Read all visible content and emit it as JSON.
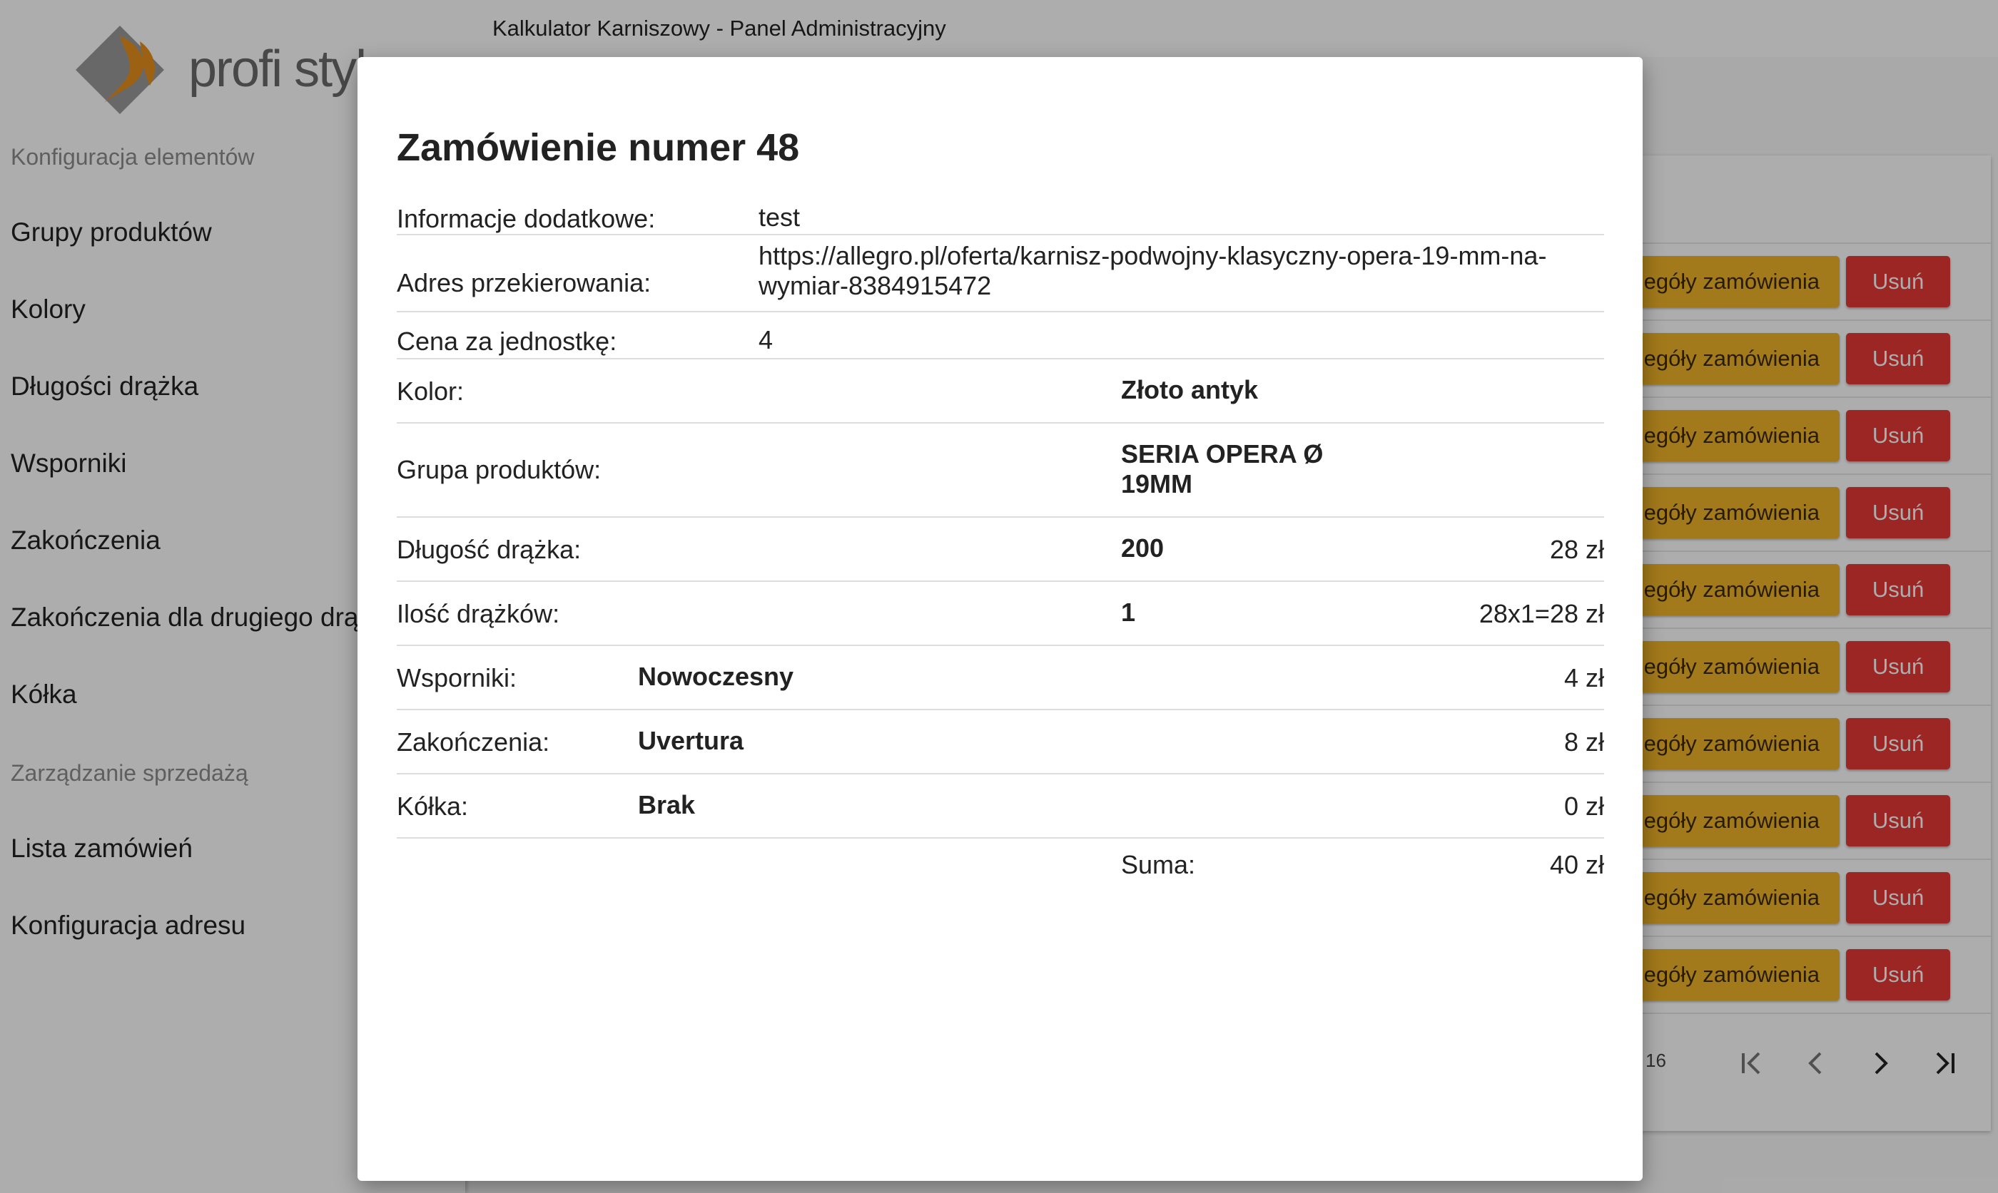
{
  "app": {
    "title": "Kalkulator Karniszowy - Panel Administracyjny",
    "logo_text": "profi styl"
  },
  "sidebar": {
    "sections": [
      {
        "title": "Konfiguracja elementów",
        "items": [
          "Grupy produktów",
          "Kolory",
          "Długości drążka",
          "Wsporniki",
          "Zakończenia",
          "Zakończenia dla drugiego drążka",
          "Kółka"
        ]
      },
      {
        "title": "Zarządzanie sprzedażą",
        "items": [
          "Lista zamówień",
          "Konfiguracja adresu"
        ]
      }
    ]
  },
  "orders_table": {
    "details_label": "Szczegóły zamówienia",
    "delete_label": "Usuń",
    "row_count": 10,
    "pager_count": "16"
  },
  "colors": {
    "details_button": "#f0b429",
    "delete_button": "#e53935",
    "logo_orange": "#e8901c",
    "logo_gray": "#9a9a9a"
  },
  "modal": {
    "title": "Zamówienie numer 48",
    "info": [
      {
        "label": "Informacje dodatkowe:",
        "value": "test"
      },
      {
        "label": "Adres przekierowania:",
        "value": "https://allegro.pl/oferta/karnisz-podwojny-klasyczny-opera-19-mm-na-wymiar-8384915472"
      },
      {
        "label": "Cena za jednostkę:",
        "value": "4"
      }
    ],
    "details": [
      {
        "label": "Kolor:",
        "value": "Złoto antyk",
        "price": ""
      },
      {
        "label": "Grupa produktów:",
        "value": "SERIA OPERA Ø 19MM",
        "price": ""
      },
      {
        "label": "Długość drążka:",
        "value": "200",
        "price": "28 zł"
      },
      {
        "label": "Ilość drążków:",
        "value": "1",
        "price": "28x1=28 zł"
      }
    ],
    "parts": [
      {
        "label": "Wsporniki:",
        "value": "Nowoczesny",
        "price": "4 zł"
      },
      {
        "label": "Zakończenia:",
        "value": "Uvertura",
        "price": "8 zł"
      },
      {
        "label": "Kółka:",
        "value": "Brak",
        "price": "0 zł"
      }
    ],
    "sum_label": "Suma:",
    "sum_value": "40 zł"
  }
}
